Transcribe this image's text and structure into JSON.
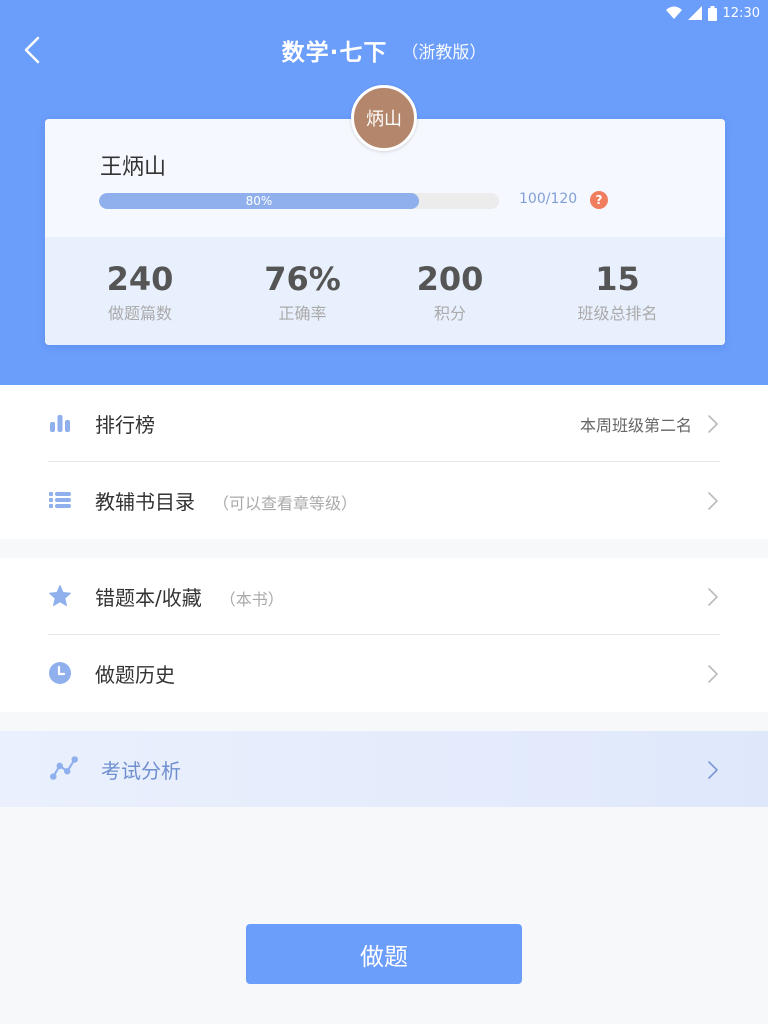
{
  "status_bar": {
    "time": "12:30"
  },
  "header": {
    "title": "数学·七下",
    "subtitle": "（浙教版）"
  },
  "profile": {
    "avatar_text": "炳山",
    "name": "王炳山",
    "progress_label": "80%",
    "progress_fraction": 0.8,
    "progress_value": "100/120",
    "help_glyph": "?",
    "stats": [
      {
        "value": "240",
        "label": "做题篇数"
      },
      {
        "value": "76%",
        "label": "正确率"
      },
      {
        "value": "200",
        "label": "积分"
      },
      {
        "value": "15",
        "label": "班级总排名"
      }
    ]
  },
  "menu": {
    "ranking": {
      "label": "排行榜",
      "right": "本周班级第二名",
      "icon": "bar-chart-icon"
    },
    "catalog": {
      "label": "教辅书目录",
      "hint": "（可以查看章等级）",
      "icon": "list-icon"
    },
    "wrongbook": {
      "label": "错题本/收藏",
      "hint": "（本书）",
      "icon": "star-icon"
    },
    "history": {
      "label": "做题历史",
      "icon": "clock-icon"
    },
    "analysis": {
      "label": "考试分析",
      "icon": "trend-icon"
    }
  },
  "action_button": {
    "label": "做题"
  },
  "colors": {
    "primary": "#6b9dfb",
    "avatar": "#b4866b",
    "help": "#ef7d5e",
    "icon": "#8fb0ec"
  }
}
